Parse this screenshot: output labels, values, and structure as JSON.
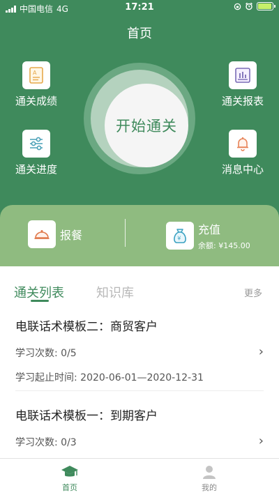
{
  "status_bar": {
    "carrier": "中国电信",
    "network": "4G",
    "time": "17:21"
  },
  "header": {
    "title": "首页"
  },
  "center_button": {
    "label": "开始通关"
  },
  "features": {
    "scores": {
      "label": "通关成绩",
      "icon": "certificate-icon"
    },
    "progress": {
      "label": "通关进度",
      "icon": "sliders-icon"
    },
    "report": {
      "label": "通关报表",
      "icon": "report-chart-icon"
    },
    "messages": {
      "label": "消息中心",
      "icon": "bell-icon"
    }
  },
  "band": {
    "order_meal": {
      "label": "报餐",
      "icon": "cloche-icon"
    },
    "recharge": {
      "label": "充值",
      "balance": "余额: ¥145.00",
      "icon": "money-bag-icon"
    }
  },
  "content_tabs": {
    "active": "通关列表",
    "inactive": "知识库",
    "more": "更多"
  },
  "templates": [
    {
      "title": "电联话术模板二：商贸客户",
      "study_count": "学习次数: 0/5",
      "period": "学习起止时间: 2020-06-01—2020-12-31"
    },
    {
      "title": "电联话术模板一：到期客户",
      "study_count": "学习次数: 0/3"
    }
  ],
  "bottom_tabs": [
    {
      "label": "首页",
      "icon": "graduation-cap-icon",
      "active": true
    },
    {
      "label": "我的",
      "icon": "user-icon",
      "active": false
    }
  ],
  "colors": {
    "primary": "#3f8a5c",
    "band": "#8fbb80",
    "ring": "#6ba882",
    "inactive_tab": "#b8b8b8"
  }
}
